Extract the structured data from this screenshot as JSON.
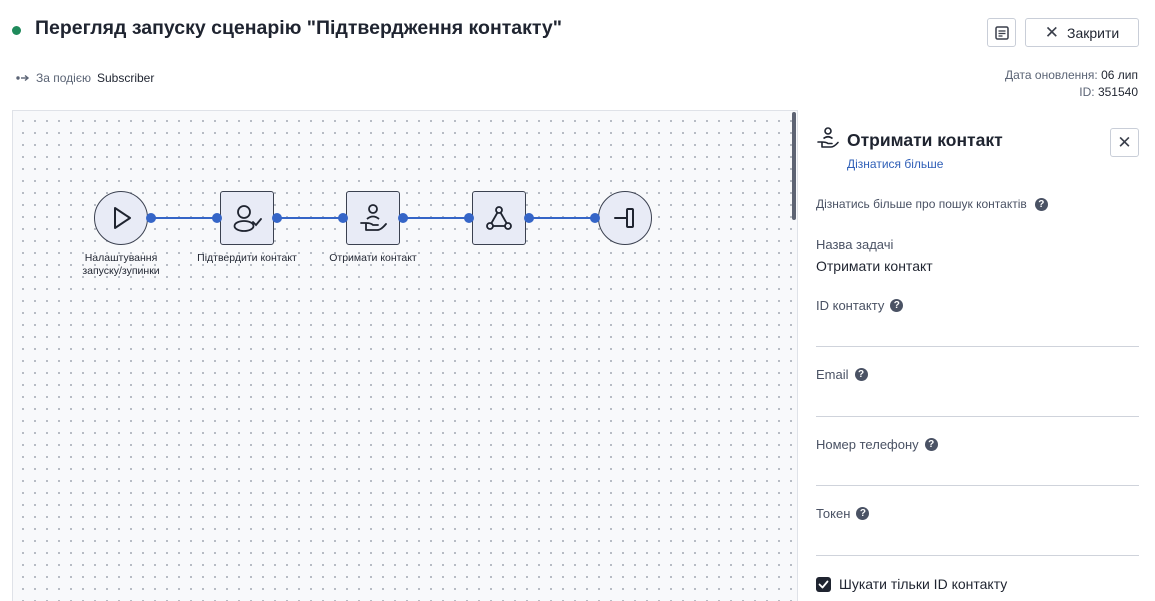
{
  "header": {
    "title": "Перегляд запуску сценарію \"Підтвердження контакту\"",
    "status_color": "#1f8a5b",
    "close_label": "Закрити",
    "trigger_label": "За подією",
    "trigger_value": "Subscriber",
    "updated_label": "Дата оновлення:",
    "updated_value": "06 лип",
    "id_label": "ID:",
    "id_value": "351540"
  },
  "flow": {
    "accent_color": "#3565c7",
    "nodes": [
      {
        "icon": "play-icon",
        "label_line1": "Налаштування",
        "label_line2": "запуску/зупинки"
      },
      {
        "icon": "user-check-icon",
        "label_line1": "Підтвердити контакт",
        "label_line2": ""
      },
      {
        "icon": "hand-user-icon",
        "label_line1": "Отримати контакт",
        "label_line2": ""
      },
      {
        "icon": "webhook-icon",
        "label_line1": "",
        "label_line2": ""
      },
      {
        "icon": "exit-icon",
        "label_line1": "",
        "label_line2": ""
      }
    ]
  },
  "panel": {
    "title": "Отримати контакт",
    "learn_more": "Дізнатися більше",
    "help_text": "Дізнатись більше про пошук контактів",
    "fields": [
      {
        "label": "Назва задачі",
        "value": "Отримати контакт",
        "help": false
      },
      {
        "label": "ID контакту",
        "value": "",
        "help": true
      },
      {
        "label": "Email",
        "value": "",
        "help": true
      },
      {
        "label": "Номер телефону",
        "value": "",
        "help": true
      },
      {
        "label": "Токен",
        "value": "",
        "help": true
      }
    ],
    "checkbox_label": "Шукати тільки ID контакту",
    "checkbox_checked": true
  }
}
